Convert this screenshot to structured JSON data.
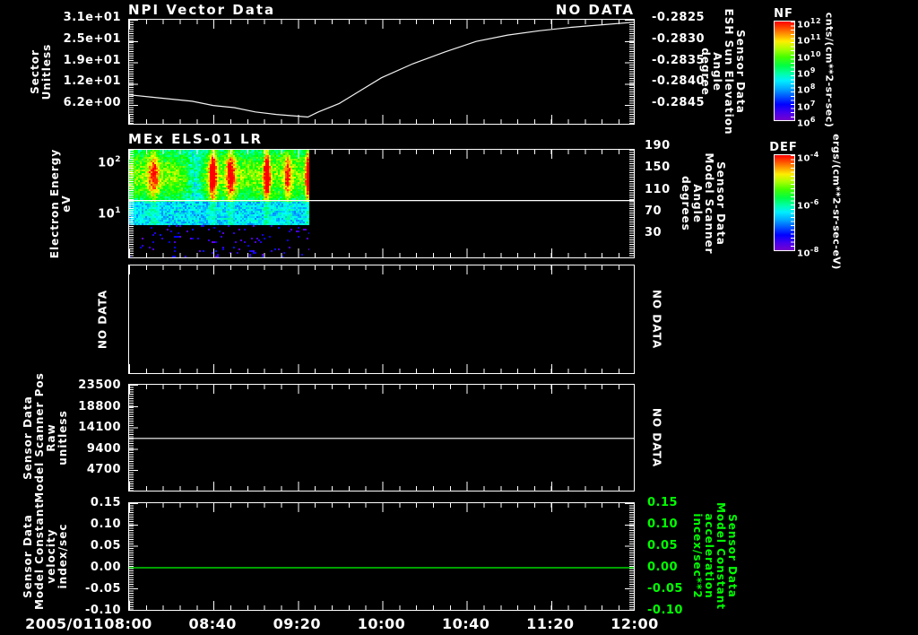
{
  "x_axis": {
    "date_label": "2005/011",
    "tick_labels": [
      "08:00",
      "08:40",
      "09:20",
      "10:00",
      "10:40",
      "11:20",
      "12:00"
    ]
  },
  "colorbars": [
    {
      "title": "NF",
      "units": "cnts/(cm**2-sr-sec)",
      "tick_labels": [
        "10^12",
        "10^11",
        "10^10",
        "10^9",
        "10^8",
        "10^7",
        "10^6"
      ]
    },
    {
      "title": "DEF",
      "units": "ergs/(cm**2-sr-sec-eV)",
      "tick_labels": [
        "10^-4",
        "10^-6",
        "10^-8"
      ]
    }
  ],
  "chart_data": [
    {
      "type": "line",
      "title": "NPI Vector Data",
      "status": "NO DATA",
      "left_axis": {
        "label_lines": [
          "Sector",
          "Unitless"
        ],
        "tick_labels": [
          "3.1e+01",
          "2.5e+01",
          "1.9e+01",
          "1.2e+01",
          "6.2e+00"
        ]
      },
      "right_axis": {
        "label_lines": [
          "Sensor Data",
          "ESH Sun Elevation",
          "Angle",
          "degree"
        ],
        "tick_labels": [
          "-0.2825",
          "-0.2830",
          "-0.2835",
          "-0.2840",
          "-0.2845"
        ]
      },
      "series": [
        {
          "name": "ESH Sun Elevation Angle",
          "color": "#f2f2f2",
          "axis": "right",
          "x_minutes": [
            0,
            10,
            20,
            30,
            40,
            50,
            60,
            70,
            80,
            85,
            90,
            100,
            110,
            120,
            135,
            150,
            165,
            180,
            195,
            210,
            225,
            240
          ],
          "values": [
            -0.2843,
            -0.28435,
            -0.2844,
            -0.28445,
            -0.28455,
            -0.2846,
            -0.2847,
            -0.28476,
            -0.2848,
            -0.28482,
            -0.2847,
            -0.2845,
            -0.2842,
            -0.2839,
            -0.28357,
            -0.2833,
            -0.28305,
            -0.2829,
            -0.2828,
            -0.28272,
            -0.28266,
            -0.2826
          ]
        }
      ]
    },
    {
      "type": "spectrogram",
      "title": "MEx ELS-01 LR",
      "left_axis": {
        "label_lines": [
          "Electron Energy",
          "eV"
        ],
        "scale": "log",
        "tick_labels": [
          "10^2",
          "10^1"
        ]
      },
      "right_axis": {
        "label_lines": [
          "Sensor Data",
          "Model Scanner",
          "Angle",
          "degrees"
        ],
        "tick_labels": [
          "190",
          "150",
          "110",
          "70",
          "30"
        ]
      },
      "series": [
        {
          "name": "Model Scanner Angle",
          "color": "#ffffff",
          "axis": "right",
          "constant": 90
        }
      ],
      "spectrogram": {
        "time_start": "08:00",
        "time_end": "09:25",
        "energy_range_ev": [
          5,
          200
        ],
        "seed": 7,
        "streaks": [
          {
            "pos": 0.13,
            "amp": 0.3,
            "w": 0.02
          },
          {
            "pos": 0.36,
            "amp": -0.22,
            "w": 0.035
          },
          {
            "pos": 0.46,
            "amp": 0.5,
            "w": 0.014
          },
          {
            "pos": 0.56,
            "amp": 0.38,
            "w": 0.018
          },
          {
            "pos": 0.76,
            "amp": 0.55,
            "w": 0.012
          },
          {
            "pos": 0.875,
            "amp": 0.3,
            "w": 0.014
          },
          {
            "pos": 0.99,
            "amp": 0.55,
            "w": 0.01
          }
        ],
        "description": "ELS electron energy flux spectrogram; data present 08:00-09:25 only, enhanced flux ~08:10, 08:37-08:50, 09:05-09:10, 09:24; scattered low counts below ~6 eV"
      }
    },
    {
      "type": "empty",
      "status_left": "NO DATA",
      "status_right": "NO DATA"
    },
    {
      "type": "line",
      "status_right": "NO DATA",
      "left_axis": {
        "label_lines": [
          "Sensor Data",
          "Model Scanner Pos",
          "Raw",
          "unitless"
        ],
        "tick_labels": [
          "23500",
          "18800",
          "14100",
          "9400",
          "4700"
        ]
      },
      "series": [
        {
          "name": "Model Scanner Pos",
          "color": "#ffffff",
          "axis": "left",
          "constant": 11750
        }
      ]
    },
    {
      "type": "line",
      "left_axis": {
        "label_lines": [
          "Sensor Data",
          "Model Constant",
          "velocity",
          "index/sec"
        ],
        "tick_labels": [
          "0.15",
          "0.10",
          "0.05",
          "0.00",
          "-0.05",
          "-0.10"
        ]
      },
      "right_axis": {
        "label_lines": [
          "Sensor Data",
          "Model Constant",
          "acceleration",
          "incex/sec**2"
        ],
        "color": "#00ff00",
        "tick_labels": [
          "0.15",
          "0.10",
          "0.05",
          "0.00",
          "-0.05",
          "-0.10"
        ]
      },
      "series": [
        {
          "name": "Model Constant acceleration",
          "color": "#00ff00",
          "axis": "left",
          "constant": 0.0
        }
      ]
    }
  ]
}
